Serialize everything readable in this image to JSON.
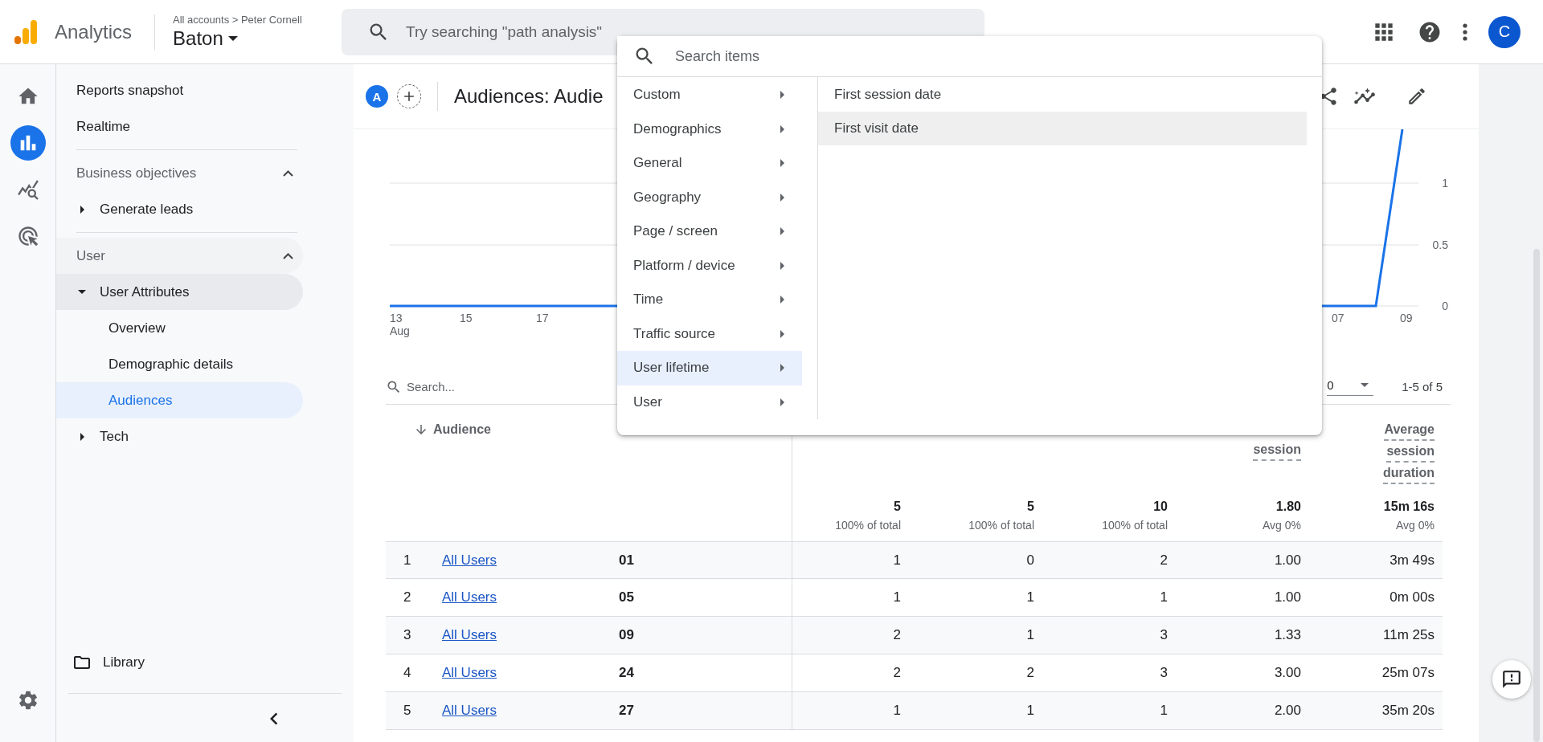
{
  "topbar": {
    "product": "Analytics",
    "breadcrumb": "All accounts > Peter Cornell",
    "property": "Baton",
    "search": {
      "placeholder": "Try searching \"path analysis\""
    },
    "avatar": "C"
  },
  "rail": [
    {
      "kind": "home",
      "selected": false
    },
    {
      "kind": "reports",
      "selected": true
    },
    {
      "kind": "explore",
      "selected": false
    },
    {
      "kind": "advertising",
      "selected": false
    }
  ],
  "nav": {
    "top_items": [
      {
        "label": "Reports snapshot"
      },
      {
        "label": "Realtime"
      }
    ],
    "sections": [
      {
        "title": "Business objectives",
        "expanded": true,
        "groups": [
          {
            "label": "Generate leads",
            "expanded": false
          }
        ]
      },
      {
        "title": "User",
        "expanded": true,
        "groups": [
          {
            "label": "User Attributes",
            "expanded": true,
            "children": [
              {
                "label": "Overview",
                "selected": false
              },
              {
                "label": "Demographic details",
                "selected": false
              },
              {
                "label": "Audiences",
                "selected": true
              }
            ]
          },
          {
            "label": "Tech",
            "expanded": false
          }
        ]
      }
    ],
    "library": "Library"
  },
  "report": {
    "comparison_chip": "A",
    "title": "Audiences: Audie"
  },
  "chart": {
    "y_ticks": [
      "1",
      "0.5",
      "0"
    ],
    "x_ticks": [
      {
        "label": "13",
        "sub": "Aug"
      },
      {
        "label": "15"
      },
      {
        "label": "17"
      },
      {
        "label": "07"
      },
      {
        "label": "09"
      }
    ]
  },
  "table": {
    "search": {
      "placeholder": "Search..."
    },
    "rows_per_page": "0",
    "pagination": "1-5 of 5",
    "columns": {
      "audience": "Audience",
      "metric_headers": [
        {
          "label": "session"
        },
        {
          "label": "Average session duration"
        }
      ]
    },
    "totals": [
      {
        "value": "5",
        "note": "100% of total"
      },
      {
        "value": "5",
        "note": "100% of total"
      },
      {
        "value": "10",
        "note": "100% of total"
      },
      {
        "value": "1.80",
        "note": "Avg 0%"
      },
      {
        "value": "15m 16s",
        "note": "Avg 0%"
      }
    ],
    "rows": [
      {
        "rank": "1",
        "audience": "All Users",
        "column_3": "01",
        "metrics": [
          "1",
          "0",
          "2",
          "1.00",
          "3m 49s"
        ]
      },
      {
        "rank": "2",
        "audience": "All Users",
        "column_3": "05",
        "metrics": [
          "1",
          "1",
          "1",
          "1.00",
          "0m 00s"
        ]
      },
      {
        "rank": "3",
        "audience": "All Users",
        "column_3": "09",
        "metrics": [
          "2",
          "1",
          "3",
          "1.33",
          "11m 25s"
        ]
      },
      {
        "rank": "4",
        "audience": "All Users",
        "column_3": "24",
        "metrics": [
          "2",
          "2",
          "3",
          "3.00",
          "25m 07s"
        ]
      },
      {
        "rank": "5",
        "audience": "All Users",
        "column_3": "27",
        "metrics": [
          "1",
          "1",
          "1",
          "2.00",
          "35m 20s"
        ]
      }
    ]
  },
  "dimension_menu": {
    "search": {
      "placeholder": "Search items"
    },
    "categories": [
      {
        "label": "Custom",
        "selected": false
      },
      {
        "label": "Demographics",
        "selected": false
      },
      {
        "label": "General",
        "selected": false
      },
      {
        "label": "Geography",
        "selected": false
      },
      {
        "label": "Page / screen",
        "selected": false
      },
      {
        "label": "Platform / device",
        "selected": false
      },
      {
        "label": "Time",
        "selected": false
      },
      {
        "label": "Traffic source",
        "selected": false
      },
      {
        "label": "User lifetime",
        "selected": true
      },
      {
        "label": "User",
        "selected": false
      }
    ],
    "items": [
      {
        "label": "First session date",
        "highlighted": false
      },
      {
        "label": "First visit date",
        "highlighted": true
      }
    ]
  }
}
